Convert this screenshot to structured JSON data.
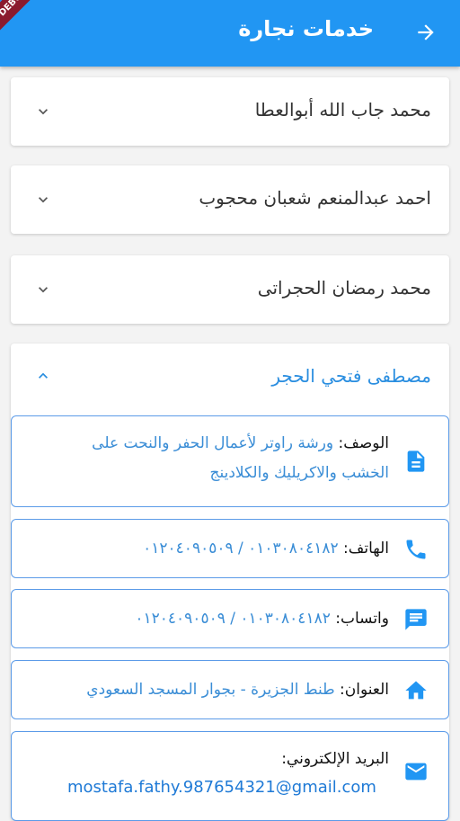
{
  "appbar": {
    "title": "خدمات نجارة",
    "back_icon": "arrow-forward-icon",
    "color": "#2196f3"
  },
  "debug_banner": "DEBUG",
  "panels": [
    {
      "title": "محمد جاب الله أبوالعطا",
      "icon": "chevron-down-icon"
    },
    {
      "title": "احمد عبدالمنعم شعبان محجوب",
      "icon": "chevron-down-icon"
    },
    {
      "title": "محمد رمضان الحجراتى",
      "icon": "chevron-down-icon"
    },
    {
      "title": "مصطفى فتحي الحجر",
      "icon": "chevron-up-icon",
      "expanded": true
    }
  ],
  "details": {
    "description": {
      "label": "الوصف:",
      "value": "ورشة راوتر لأعمال الحفر والنحت على الخشب والاكريليك والكلادينج",
      "icon": "description-icon"
    },
    "phone": {
      "label": "الهاتف:",
      "value": "٠١٠٣٠٨٠٤١٨٢ / ٠١٢٠٤٠٩٠٥٠٩",
      "icon": "phone-icon"
    },
    "whatsapp": {
      "label": "واتساب:",
      "value": "٠١٠٣٠٨٠٤١٨٢ / ٠١٢٠٤٠٩٠٥٠٩",
      "icon": "message-icon"
    },
    "address": {
      "label": "العنوان:",
      "value": "طنط الجزيرة - بجوار المسجد السعودي",
      "icon": "home-icon"
    },
    "email": {
      "label": "البريد الإلكتروني:",
      "value": "mostafa.fathy.987654321@gmail.com",
      "icon": "mail-icon"
    }
  },
  "colors": {
    "accent": "#2196f3",
    "link": "#3a8dd6",
    "card_border": "#5c9be8"
  }
}
